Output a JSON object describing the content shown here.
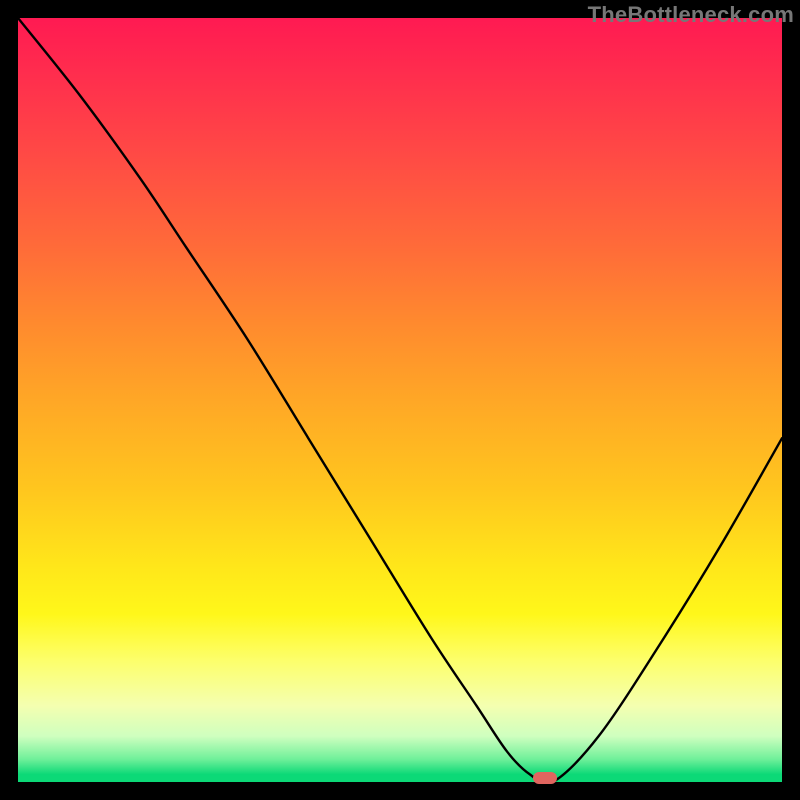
{
  "watermark": "TheBottleneck.com",
  "colors": {
    "background": "#000000",
    "gradient_top": "#ff1a52",
    "gradient_bottom": "#0cd977",
    "curve_stroke": "#000000",
    "marker_fill": "#e0655f"
  },
  "chart_data": {
    "type": "line",
    "title": "",
    "xlabel": "",
    "ylabel": "",
    "xlim": [
      0,
      100
    ],
    "ylim": [
      0,
      100
    ],
    "grid": false,
    "legend": false,
    "series": [
      {
        "name": "bottleneck-curve",
        "x": [
          0,
          8,
          16,
          22,
          30,
          38,
          46,
          54,
          60,
          64,
          67,
          70,
          76,
          84,
          92,
          100
        ],
        "y": [
          100,
          90,
          79,
          70,
          58,
          45,
          32,
          19,
          10,
          4,
          1,
          0,
          6,
          18,
          31,
          45
        ]
      }
    ],
    "markers": [
      {
        "name": "optimum-point",
        "x": 69,
        "y": 0.5
      }
    ]
  }
}
